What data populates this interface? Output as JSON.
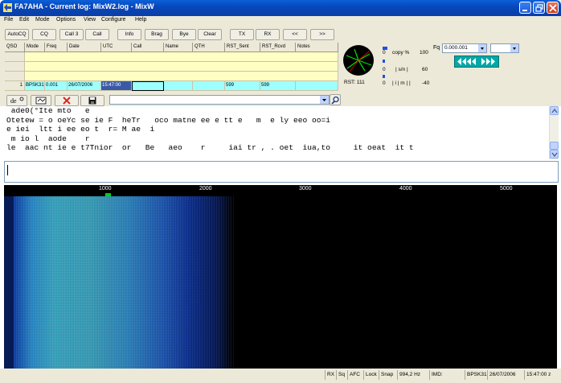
{
  "window": {
    "title": "FA7AHA - Current log: MixW2.log - MixW"
  },
  "menu": [
    "File",
    "Edit",
    "Mode",
    "Options",
    "View",
    "Configure",
    "Help"
  ],
  "toolbar": {
    "buttons": [
      "AutoCQ",
      "CQ",
      "Call 3",
      "Call",
      "Info",
      "Brag",
      "Bye",
      "Clear",
      "TX",
      "RX",
      "<<",
      ">>"
    ]
  },
  "log": {
    "columns": [
      "QSO",
      "Mode",
      "Freq",
      "Date",
      "UTC",
      "Call",
      "Name",
      "QTH",
      "RST_Sent",
      "RST_Rcvd",
      "Notes"
    ],
    "row": [
      "1",
      "BPSK31",
      "0.001",
      "26/07/2006",
      "15:47:00",
      "",
      "",
      "",
      "599",
      "599",
      ""
    ]
  },
  "meters": {
    "copy_value": "0",
    "copy_label": "copy %",
    "copy_max": "100",
    "sn_value": "0",
    "sn_label": "| s/n |",
    "sn_max": "60",
    "imd_value": "0",
    "imd_label": "| i | m | |",
    "imd_max": "-40",
    "rst": "RST: 111"
  },
  "freq": {
    "label": "Fq",
    "value": "0.000.001",
    "mode_value": ""
  },
  "rx_text": [
    " ade0(°Ite mto   e",
    "Otetew = o oeYc se ie F  heTr   oco matne ee e tt e   m  e ly eeo oo=i",
    "e iei  ltt i ee eo t  r= M ae  i",
    " m io l  aode    r",
    "le  aac nt ie e t7Tnior  or   Be   aeo    r     iai tr , . oet  iua,to     it oeat  it t"
  ],
  "tx_text": "",
  "waterfall": {
    "scale": [
      "1000",
      "2000",
      "3000",
      "4000",
      "5000"
    ]
  },
  "status": {
    "items": [
      "RX",
      "Sq",
      "AFC",
      "Lock",
      "Snap",
      "994,2 Hz",
      "IMD:",
      "BPSK31",
      "26/07/2006",
      "15:47:00 z"
    ]
  },
  "colors": {
    "title_blue": "#0a4fc9",
    "log_yellow": "#ffffc4",
    "log_cyan": "#9effff",
    "tuner_teal": "#00a8a8"
  }
}
